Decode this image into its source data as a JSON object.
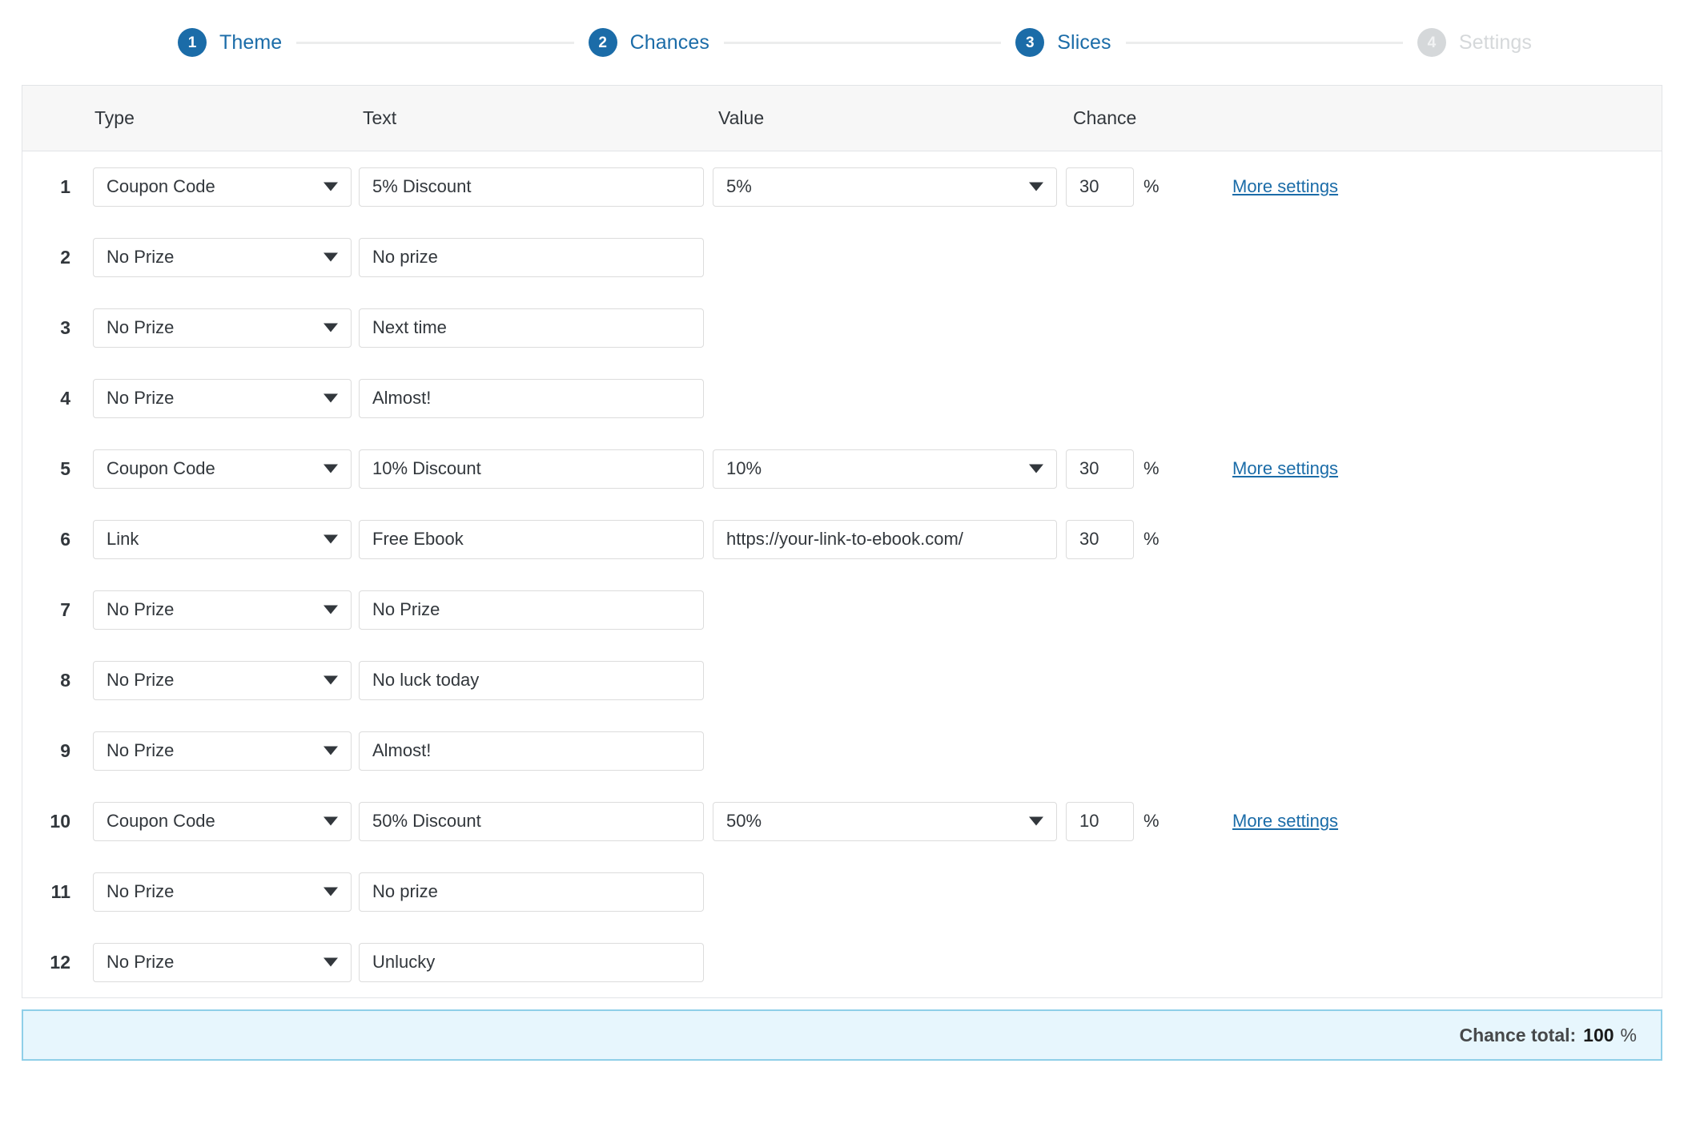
{
  "stepper": {
    "steps": [
      {
        "number": "1",
        "label": "Theme",
        "state": "active"
      },
      {
        "number": "2",
        "label": "Chances",
        "state": "active"
      },
      {
        "number": "3",
        "label": "Slices",
        "state": "active"
      },
      {
        "number": "4",
        "label": "Settings",
        "state": "inactive"
      }
    ],
    "active_color": "#1b6ca8",
    "inactive_color": "#d5d8da"
  },
  "table": {
    "headers": {
      "type": "Type",
      "text": "Text",
      "value": "Value",
      "chance": "Chance"
    },
    "percent_symbol": "%",
    "more_settings_label": "More settings",
    "rows": [
      {
        "index": "1",
        "type": "Coupon Code",
        "text": "5% Discount",
        "value": "5%",
        "value_control": "select",
        "chance": "30",
        "has_more": true
      },
      {
        "index": "2",
        "type": "No Prize",
        "text": "No prize",
        "value": "",
        "value_control": "none",
        "chance": "",
        "has_more": false
      },
      {
        "index": "3",
        "type": "No Prize",
        "text": "Next time",
        "value": "",
        "value_control": "none",
        "chance": "",
        "has_more": false
      },
      {
        "index": "4",
        "type": "No Prize",
        "text": "Almost!",
        "value": "",
        "value_control": "none",
        "chance": "",
        "has_more": false
      },
      {
        "index": "5",
        "type": "Coupon Code",
        "text": "10% Discount",
        "value": "10%",
        "value_control": "select",
        "chance": "30",
        "has_more": true
      },
      {
        "index": "6",
        "type": "Link",
        "text": "Free Ebook",
        "value": "https://your-link-to-ebook.com/",
        "value_control": "input",
        "chance": "30",
        "has_more": false
      },
      {
        "index": "7",
        "type": "No Prize",
        "text": "No Prize",
        "value": "",
        "value_control": "none",
        "chance": "",
        "has_more": false
      },
      {
        "index": "8",
        "type": "No Prize",
        "text": "No luck today",
        "value": "",
        "value_control": "none",
        "chance": "",
        "has_more": false
      },
      {
        "index": "9",
        "type": "No Prize",
        "text": "Almost!",
        "value": "",
        "value_control": "none",
        "chance": "",
        "has_more": false
      },
      {
        "index": "10",
        "type": "Coupon Code",
        "text": "50% Discount",
        "value": "50%",
        "value_control": "select",
        "chance": "10",
        "has_more": true
      },
      {
        "index": "11",
        "type": "No Prize",
        "text": "No prize",
        "value": "",
        "value_control": "none",
        "chance": "",
        "has_more": false
      },
      {
        "index": "12",
        "type": "No Prize",
        "text": "Unlucky",
        "value": "",
        "value_control": "none",
        "chance": "",
        "has_more": false
      }
    ]
  },
  "total": {
    "label": "Chance total:",
    "value": "100",
    "unit": "%"
  }
}
